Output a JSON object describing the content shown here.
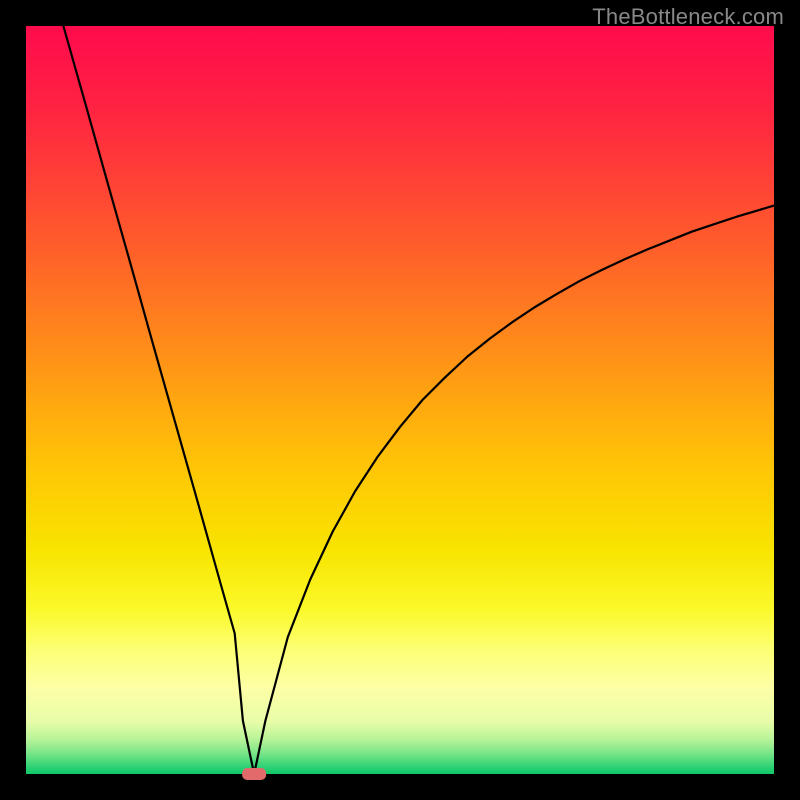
{
  "watermark": "TheBottleneck.com",
  "chart_data": {
    "type": "line",
    "title": "",
    "xlabel": "",
    "ylabel": "",
    "xlim": [
      0,
      100
    ],
    "ylim": [
      0,
      100
    ],
    "x": [
      5,
      8,
      11,
      14,
      17,
      20,
      23,
      26,
      27.9,
      29,
      30.5,
      32,
      35,
      38,
      41,
      44,
      47,
      50,
      53,
      56,
      59,
      62,
      65,
      68,
      71,
      74,
      77,
      80,
      83,
      86,
      89,
      92,
      95,
      98,
      100
    ],
    "y": [
      100,
      89.4,
      78.7,
      68.1,
      57.4,
      46.8,
      36.2,
      25.5,
      18.8,
      7.1,
      0,
      7.1,
      18.3,
      26.0,
      32.4,
      37.8,
      42.4,
      46.4,
      50.0,
      53.0,
      55.8,
      58.2,
      60.4,
      62.4,
      64.2,
      65.9,
      67.4,
      68.8,
      70.1,
      71.3,
      72.5,
      73.5,
      74.5,
      75.4,
      76.0
    ],
    "marker": {
      "x": 30.5,
      "y": 0,
      "color": "#e26a6a"
    },
    "background_gradient": {
      "stops": [
        {
          "offset": 0.0,
          "color": "#ff0b4c"
        },
        {
          "offset": 0.1,
          "color": "#ff2043"
        },
        {
          "offset": 0.2,
          "color": "#ff3f37"
        },
        {
          "offset": 0.3,
          "color": "#ff5f2a"
        },
        {
          "offset": 0.4,
          "color": "#ff821d"
        },
        {
          "offset": 0.5,
          "color": "#ffa610"
        },
        {
          "offset": 0.6,
          "color": "#ffc805"
        },
        {
          "offset": 0.7,
          "color": "#f8e400"
        },
        {
          "offset": 0.78,
          "color": "#fbf92a"
        },
        {
          "offset": 0.83,
          "color": "#fcff70"
        },
        {
          "offset": 0.885,
          "color": "#fdffa6"
        },
        {
          "offset": 0.93,
          "color": "#e8fca8"
        },
        {
          "offset": 0.955,
          "color": "#b4f397"
        },
        {
          "offset": 0.975,
          "color": "#6fe385"
        },
        {
          "offset": 0.99,
          "color": "#2fd274"
        },
        {
          "offset": 1.0,
          "color": "#0ec768"
        }
      ]
    },
    "border_color": "#000000",
    "border_width": 26,
    "line_color": "#000000",
    "line_width": 2.2
  }
}
